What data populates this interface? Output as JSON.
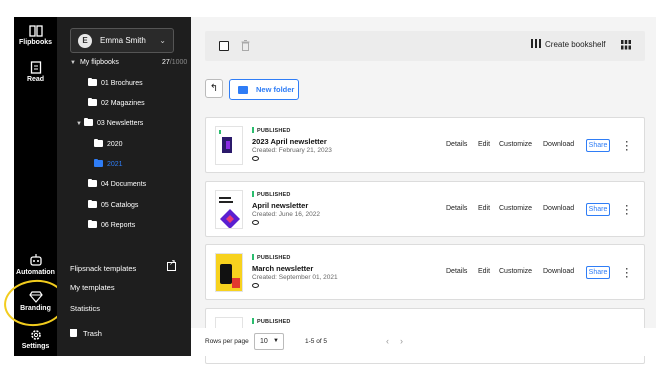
{
  "rail": {
    "flipbooks_label": "Flipbooks",
    "read_label": "Read",
    "automation_label": "Automation",
    "branding_label": "Branding",
    "settings_label": "Settings"
  },
  "user": {
    "initial": "E",
    "name": "Emma Smith"
  },
  "tree": {
    "root_label": "My flipbooks",
    "count_used": "27",
    "count_total": "/1000",
    "folders": [
      {
        "label": "01 Brochures"
      },
      {
        "label": "02 Magazines"
      },
      {
        "label": "03 Newsletters"
      },
      {
        "label": "2020"
      },
      {
        "label": "2021"
      },
      {
        "label": "04 Documents"
      },
      {
        "label": "05 Catalogs"
      },
      {
        "label": "06 Reports"
      }
    ]
  },
  "panel_links": {
    "templates": "Flipsnack templates",
    "my_templates": "My templates",
    "statistics": "Statistics",
    "trash": "Trash"
  },
  "toolbar": {
    "create_bookshelf": "Create bookshelf"
  },
  "new_folder_label": "New folder",
  "actions": {
    "details": "Details",
    "edit": "Edit",
    "customize": "Customize",
    "download": "Download",
    "share": "Share"
  },
  "cards": [
    {
      "status": "PUBLISHED",
      "title": "2023 April newsletter",
      "created": "Created: February 21, 2023"
    },
    {
      "status": "PUBLISHED",
      "title": "April newsletter",
      "created": "Created: June 16, 2022"
    },
    {
      "status": "PUBLISHED",
      "title": "March newsletter",
      "created": "Created: September 01, 2021"
    },
    {
      "status": "PUBLISHED",
      "title": "",
      "created": ""
    }
  ],
  "pagination": {
    "rows_label": "Rows per page",
    "rows_value": "10",
    "range": "1-5 of 5"
  },
  "colors": {
    "accent": "#2f7df6",
    "sidebar": "#1e1e1e",
    "rail": "#000000",
    "highlight": "#f2cc1d",
    "published": "#2bbd6e"
  }
}
